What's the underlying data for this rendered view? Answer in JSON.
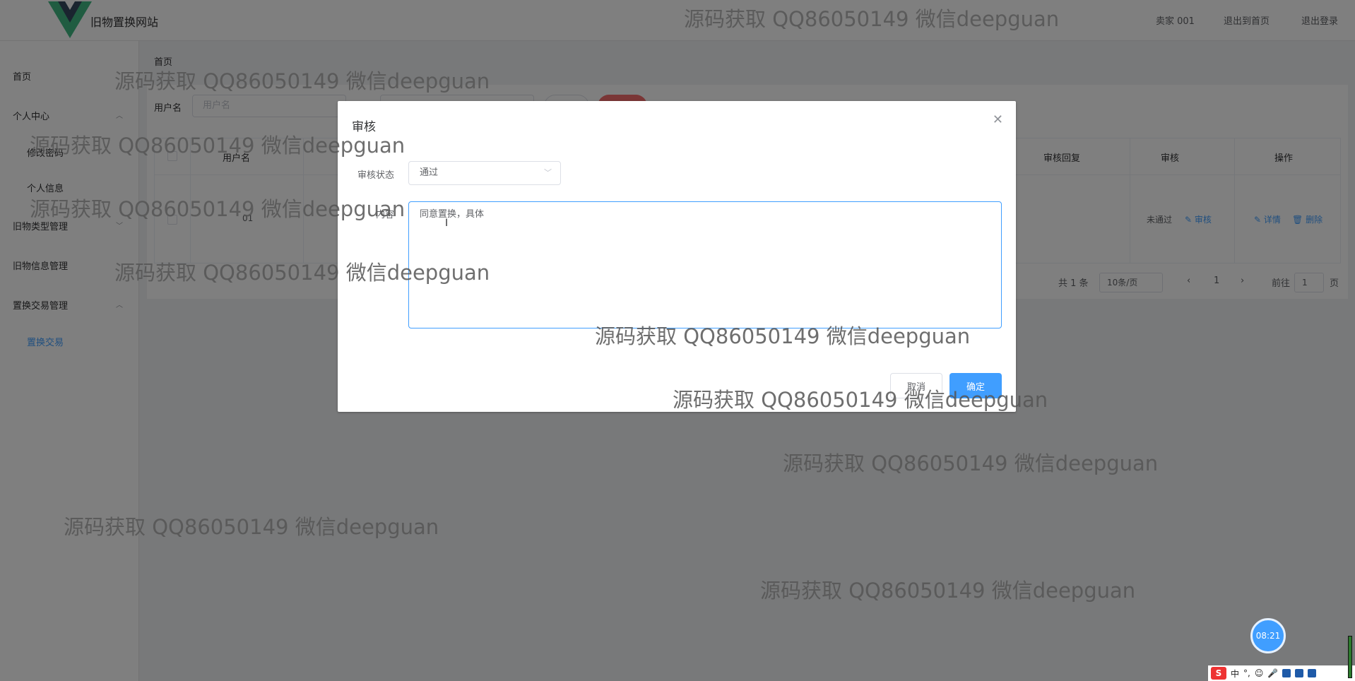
{
  "header": {
    "site_title": "旧物置换网站",
    "user": "卖家 001",
    "back_home": "退出到首页",
    "logout": "退出登录"
  },
  "sidebar": {
    "items": [
      {
        "label": "首页"
      },
      {
        "label": "个人中心"
      },
      {
        "label": "修改密码"
      },
      {
        "label": "个人信息"
      },
      {
        "label": "旧物类型管理"
      },
      {
        "label": "旧物信息管理"
      },
      {
        "label": "置换交易管理"
      },
      {
        "label": "置换交易"
      }
    ]
  },
  "breadcrumb": "首页",
  "search": {
    "label": "用户名",
    "placeholder": "用户名"
  },
  "table": {
    "headers": [
      "用户名",
      "审核回复",
      "审核",
      "操作"
    ],
    "row": {
      "username": "01",
      "status": "未通过",
      "audit_link": "审核",
      "detail_link": "详情",
      "delete_link": "删除"
    }
  },
  "pagination": {
    "total": "共 1 条",
    "page_size": "10条/页",
    "current_page": "1",
    "goto_label": "前往",
    "goto_value": "1",
    "page_suffix": "页"
  },
  "dialog": {
    "title": "审核",
    "status_label": "审核状态",
    "status_value": "通过",
    "content_label": "内容",
    "content_value": "同意置换，具体",
    "cancel": "取消",
    "confirm": "确定"
  },
  "watermark": "源码获取 QQ86050149 微信deepguan",
  "clock": "08:21",
  "ime": {
    "lang": "中"
  },
  "colors": {
    "primary": "#409eff",
    "danger": "#f56c6c",
    "overlay": "rgba(0,0,0,0.5)"
  }
}
